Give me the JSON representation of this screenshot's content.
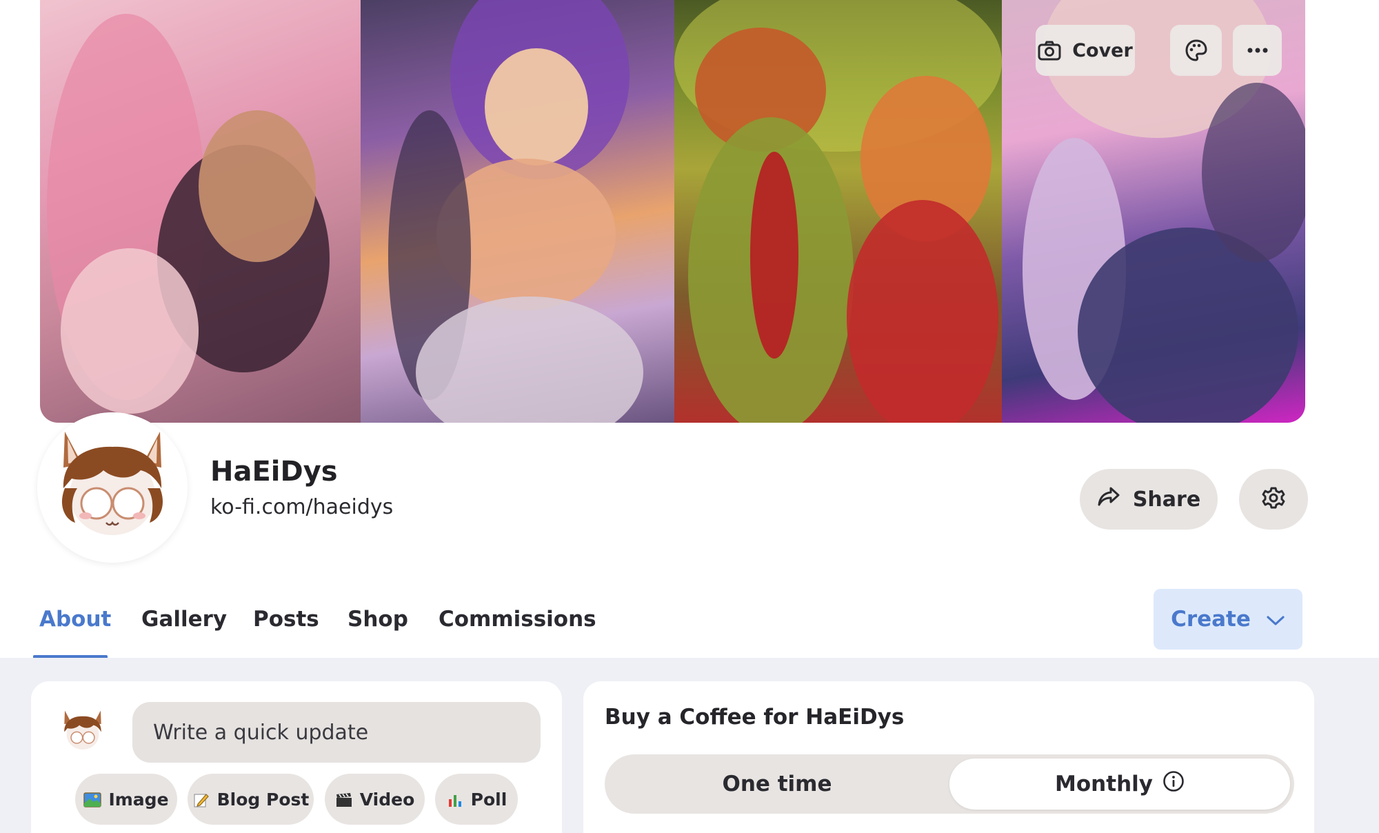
{
  "cover": {
    "cover_button_label": "Cover"
  },
  "profile": {
    "name": "HaEiDys",
    "url": "ko-fi.com/haeidys",
    "share_label": "Share"
  },
  "tabs": [
    {
      "label": "About",
      "active": true
    },
    {
      "label": "Gallery",
      "active": false
    },
    {
      "label": "Posts",
      "active": false
    },
    {
      "label": "Shop",
      "active": false
    },
    {
      "label": "Commissions",
      "active": false
    }
  ],
  "create": {
    "label": "Create"
  },
  "quick_update": {
    "placeholder": "Write a quick update",
    "buttons": [
      {
        "label": "Image",
        "icon": "image-icon"
      },
      {
        "label": "Blog Post",
        "icon": "pencil-icon"
      },
      {
        "label": "Video",
        "icon": "clapper-icon"
      },
      {
        "label": "Poll",
        "icon": "bar-chart-icon"
      }
    ]
  },
  "coffee": {
    "title": "Buy a Coffee for HaEiDys",
    "options": [
      {
        "label": "One time",
        "selected": false
      },
      {
        "label": "Monthly",
        "selected": true
      }
    ]
  },
  "colors": {
    "accent_blue": "#4a79cc",
    "create_bg": "#dde9fb",
    "pill_bg": "#e8e4e2",
    "content_bg": "#eef0f5"
  }
}
